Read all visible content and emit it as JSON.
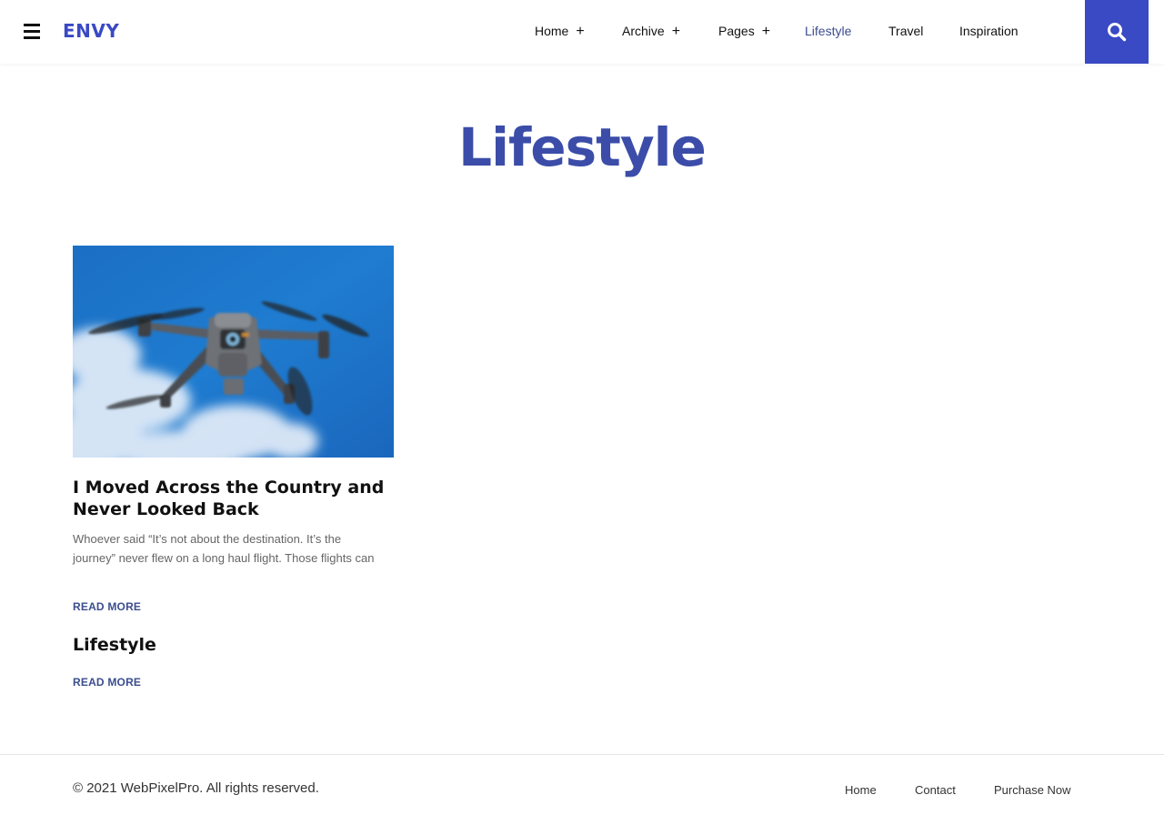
{
  "colors": {
    "accent": "#3a49c4",
    "title": "#3b4da8",
    "active_nav": "#3b4d8e",
    "text": "#111111",
    "muted": "#666666"
  },
  "header": {
    "logo": "ENVY",
    "nav": [
      {
        "label": "Home",
        "has_submenu": true
      },
      {
        "label": "Archive",
        "has_submenu": true
      },
      {
        "label": "Pages",
        "has_submenu": true
      },
      {
        "label": "Lifestyle",
        "has_submenu": false,
        "active": true
      },
      {
        "label": "Travel",
        "has_submenu": false
      },
      {
        "label": "Inspiration",
        "has_submenu": false
      }
    ],
    "plus_symbol": "+",
    "search_icon": "search-icon",
    "menu_icon": "hamburger-icon"
  },
  "page": {
    "title": "Lifestyle"
  },
  "posts": [
    {
      "title": "I Moved Across the Country and Never Looked Back",
      "excerpt": "Whoever said “It’s not about the destination. It’s the journey” never flew on a long haul flight. Those flights can",
      "read_more": "READ MORE",
      "image": "drone-in-blue-sky"
    }
  ],
  "category": {
    "title": "Lifestyle",
    "read_more": "READ MORE"
  },
  "footer": {
    "copyright": "© 2021 WebPixelPro. All rights reserved.",
    "links": [
      {
        "label": "Home"
      },
      {
        "label": "Contact"
      },
      {
        "label": "Purchase Now"
      }
    ]
  }
}
